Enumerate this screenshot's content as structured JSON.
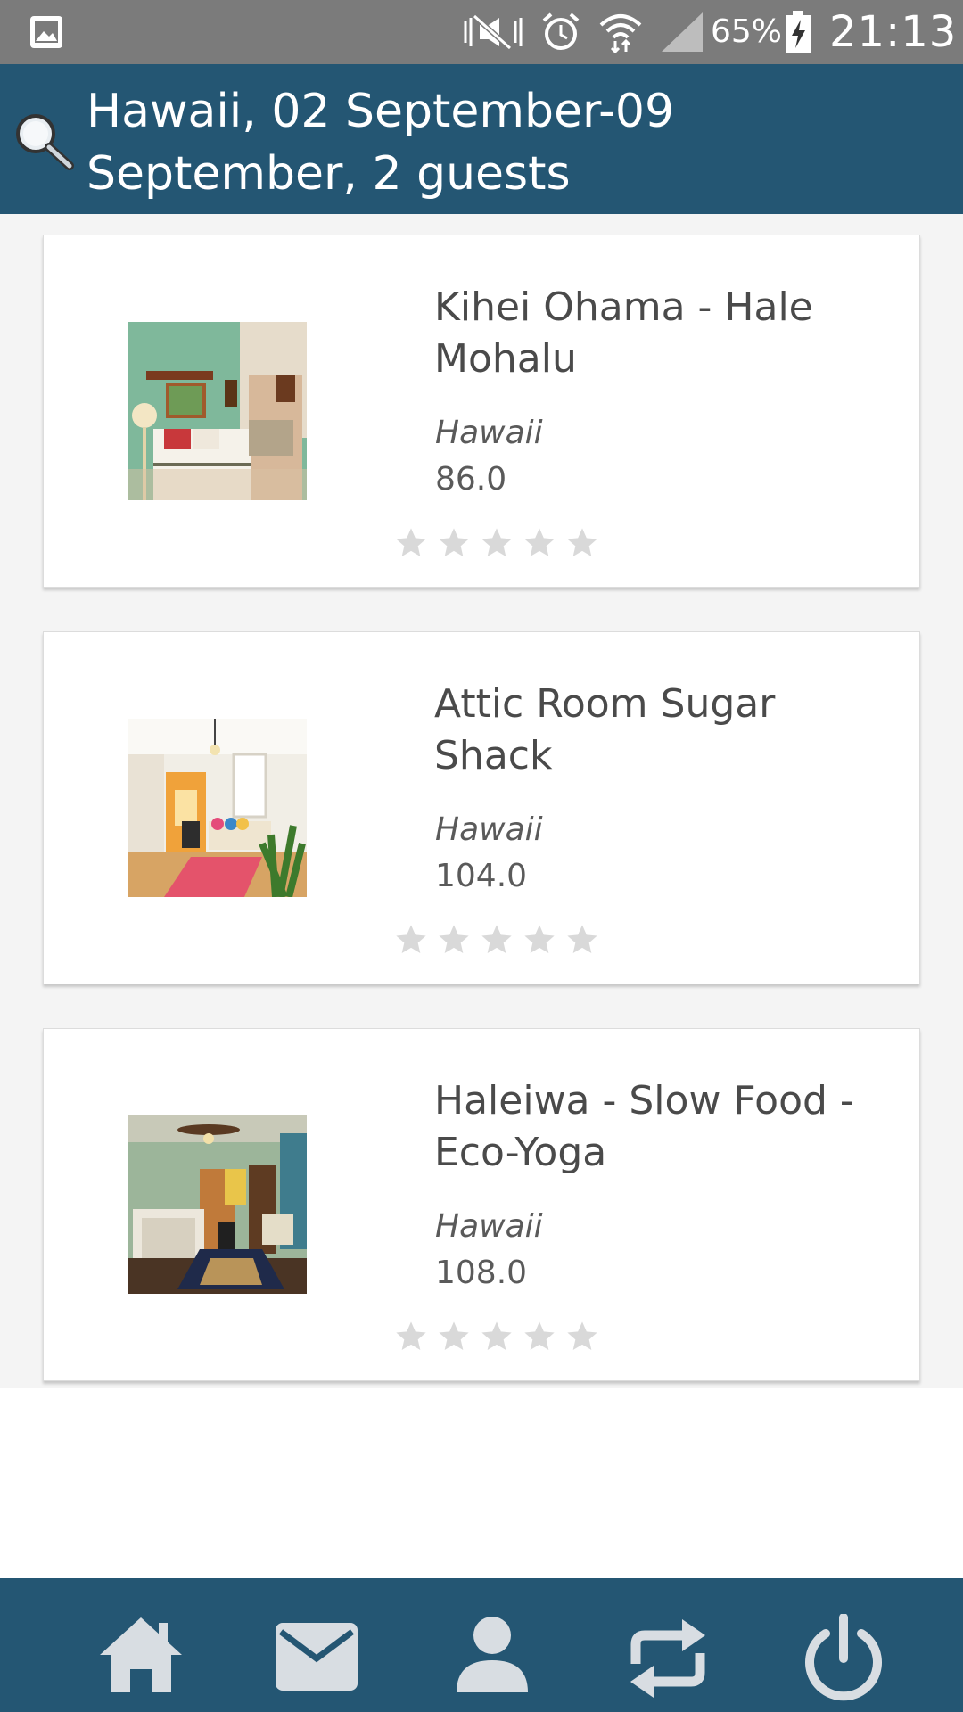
{
  "status_bar": {
    "icons": [
      "gallery-icon",
      "silent-icon",
      "alarm-icon",
      "wifi-icon",
      "signal-icon",
      "battery-charging-icon"
    ],
    "battery_percent": "65%",
    "time": "21:13"
  },
  "header": {
    "search_icon": "search-icon",
    "title": "Hawaii, 02 September-09 September, 2 guests"
  },
  "listings": [
    {
      "name": "Kihei Ohama - Hale Mohalu",
      "location": "Hawaii",
      "price": "86.0",
      "rating": 0,
      "max_rating": 5
    },
    {
      "name": "Attic Room Sugar Shack",
      "location": "Hawaii",
      "price": "104.0",
      "rating": 0,
      "max_rating": 5
    },
    {
      "name": "Haleiwa - Slow Food - Eco-Yoga",
      "location": "Hawaii",
      "price": "108.0",
      "rating": 0,
      "max_rating": 5
    }
  ],
  "bottom_nav": {
    "items": [
      "home-icon",
      "mail-icon",
      "profile-icon",
      "repeat-icon",
      "power-icon"
    ]
  },
  "colors": {
    "header_bg": "#245673",
    "status_bar_bg": "#7b7b7b",
    "nav_icon": "#d8dde2",
    "star_empty": "#d9d9d9"
  }
}
